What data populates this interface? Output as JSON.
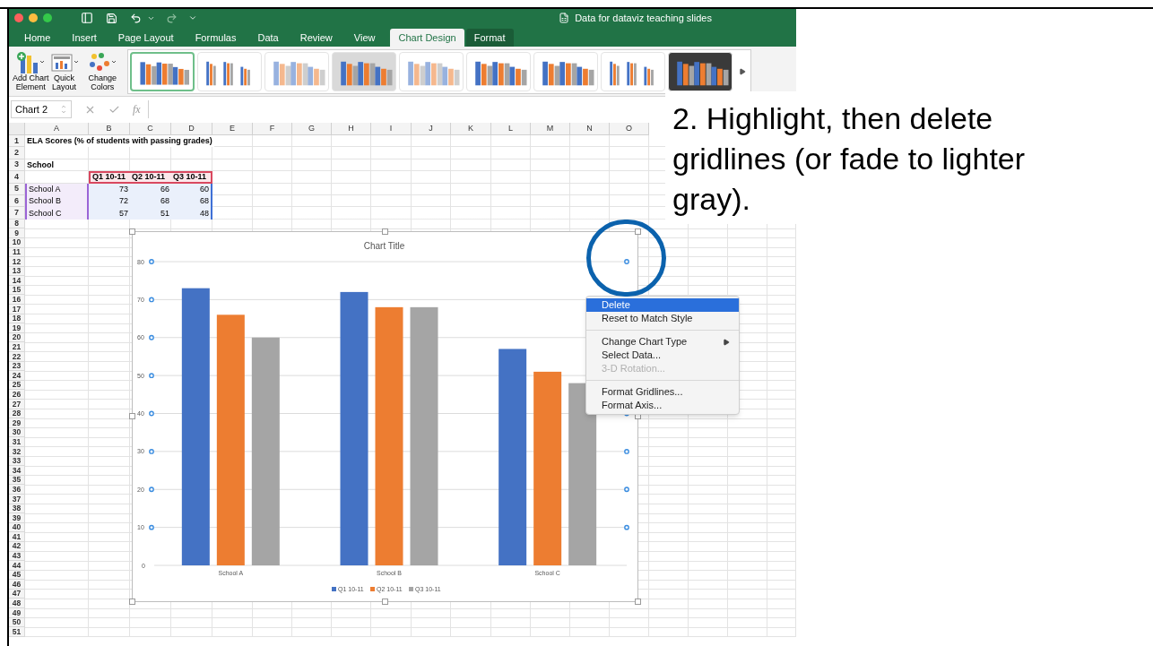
{
  "window": {
    "title": "Data for dataviz teaching slides"
  },
  "tabs": [
    {
      "label": "Home",
      "selected": false,
      "contextual": false
    },
    {
      "label": "Insert",
      "selected": false,
      "contextual": false
    },
    {
      "label": "Page Layout",
      "selected": false,
      "contextual": false
    },
    {
      "label": "Formulas",
      "selected": false,
      "contextual": false
    },
    {
      "label": "Data",
      "selected": false,
      "contextual": false
    },
    {
      "label": "Review",
      "selected": false,
      "contextual": false
    },
    {
      "label": "View",
      "selected": false,
      "contextual": false
    },
    {
      "label": "Chart Design",
      "selected": true,
      "contextual": true
    },
    {
      "label": "Format",
      "selected": false,
      "contextual": true
    }
  ],
  "ribbon": {
    "buttons": [
      {
        "kind": "add-element",
        "lines": [
          "Add Chart",
          "Element"
        ]
      },
      {
        "kind": "quick-layout",
        "lines": [
          "Quick",
          "Layout"
        ]
      },
      {
        "kind": "colors",
        "lines": [
          "Change",
          "Colors"
        ]
      }
    ],
    "chart_styles": [
      {
        "kind": "plain",
        "selected": true
      },
      {
        "kind": "thin",
        "selected": false
      },
      {
        "kind": "pale",
        "selected": false
      },
      {
        "kind": "shaded",
        "selected": false
      },
      {
        "kind": "pale",
        "selected": false
      },
      {
        "kind": "plain",
        "selected": false
      },
      {
        "kind": "plain",
        "selected": false
      },
      {
        "kind": "thin",
        "selected": false
      },
      {
        "kind": "dark",
        "selected": false
      }
    ]
  },
  "formula_bar": {
    "name_box": "Chart 2",
    "function_label": "fx"
  },
  "sheet": {
    "columns": [
      "A",
      "B",
      "C",
      "D",
      "E",
      "F",
      "G",
      "H",
      "I",
      "J",
      "K",
      "L",
      "M",
      "N",
      "O"
    ],
    "rows": [
      {
        "number": "1",
        "kind": "title",
        "text": "ELA Scores (% of students with passing grades)"
      },
      {
        "number": "2",
        "kind": "blank"
      },
      {
        "number": "3",
        "kind": "label",
        "text": "School"
      },
      {
        "number": "4",
        "kind": "headers",
        "cells": [
          "Q1 10-11",
          "Q2 10-11",
          "Q3 10-11"
        ]
      },
      {
        "number": "5",
        "kind": "values",
        "text": "School A",
        "cells": [
          "73",
          "66",
          "60"
        ]
      },
      {
        "number": "6",
        "kind": "values",
        "text": "School B",
        "cells": [
          "72",
          "68",
          "68"
        ]
      },
      {
        "number": "7",
        "kind": "values",
        "text": "School C",
        "cells": [
          "57",
          "51",
          "48"
        ]
      },
      {
        "number": "8",
        "kind": "blank"
      },
      {
        "number": "9",
        "kind": "blank"
      },
      {
        "number": "10",
        "kind": "blank"
      },
      {
        "number": "11",
        "kind": "blank"
      },
      {
        "number": "12",
        "kind": "blank"
      },
      {
        "number": "13",
        "kind": "blank"
      },
      {
        "number": "14",
        "kind": "blank"
      },
      {
        "number": "15",
        "kind": "blank"
      },
      {
        "number": "16",
        "kind": "blank"
      },
      {
        "number": "17",
        "kind": "blank"
      },
      {
        "number": "18",
        "kind": "blank"
      },
      {
        "number": "19",
        "kind": "blank"
      },
      {
        "number": "20",
        "kind": "blank"
      },
      {
        "number": "21",
        "kind": "blank"
      },
      {
        "number": "22",
        "kind": "blank"
      },
      {
        "number": "23",
        "kind": "blank"
      },
      {
        "number": "24",
        "kind": "blank"
      },
      {
        "number": "25",
        "kind": "blank"
      },
      {
        "number": "26",
        "kind": "blank"
      },
      {
        "number": "27",
        "kind": "blank"
      },
      {
        "number": "28",
        "kind": "blank"
      },
      {
        "number": "29",
        "kind": "blank"
      },
      {
        "number": "30",
        "kind": "blank"
      },
      {
        "number": "31",
        "kind": "blank"
      },
      {
        "number": "32",
        "kind": "blank"
      },
      {
        "number": "33",
        "kind": "blank"
      },
      {
        "number": "34",
        "kind": "blank"
      },
      {
        "number": "35",
        "kind": "blank"
      },
      {
        "number": "36",
        "kind": "blank"
      },
      {
        "number": "37",
        "kind": "blank"
      },
      {
        "number": "38",
        "kind": "blank"
      },
      {
        "number": "39",
        "kind": "blank"
      },
      {
        "number": "40",
        "kind": "blank"
      },
      {
        "number": "41",
        "kind": "blank"
      },
      {
        "number": "42",
        "kind": "blank"
      },
      {
        "number": "43",
        "kind": "blank"
      },
      {
        "number": "44",
        "kind": "blank"
      },
      {
        "number": "45",
        "kind": "blank"
      },
      {
        "number": "46",
        "kind": "blank"
      },
      {
        "number": "47",
        "kind": "blank"
      },
      {
        "number": "48",
        "kind": "blank"
      },
      {
        "number": "49",
        "kind": "blank"
      },
      {
        "number": "50",
        "kind": "blank"
      },
      {
        "number": "51",
        "kind": "blank"
      }
    ]
  },
  "chart": {
    "gridlines_selected": true,
    "chart_data": {
      "type": "bar",
      "title": "Chart Title",
      "categories": [
        "School A",
        "School B",
        "School C"
      ],
      "series": [
        {
          "name": "Q1 10-11",
          "color": "#4472c4",
          "values": [
            73,
            72,
            57
          ]
        },
        {
          "name": "Q2 10-11",
          "color": "#ed7d31",
          "values": [
            66,
            68,
            51
          ]
        },
        {
          "name": "Q3 10-11",
          "color": "#a5a5a5",
          "values": [
            60,
            68,
            48
          ]
        }
      ],
      "ylim": [
        0,
        80
      ],
      "yticks": [
        0,
        10,
        20,
        30,
        40,
        50,
        60,
        70,
        80
      ],
      "grid": true,
      "legend": "bottom"
    }
  },
  "context_menu": {
    "groups": [
      [
        {
          "label": "Delete",
          "selected": true,
          "disabled": false,
          "submenu": false
        },
        {
          "label": "Reset to Match Style",
          "selected": false,
          "disabled": false,
          "submenu": false
        }
      ],
      [
        {
          "label": "Change Chart Type",
          "selected": false,
          "disabled": false,
          "submenu": true
        },
        {
          "label": "Select Data...",
          "selected": false,
          "disabled": false,
          "submenu": false
        },
        {
          "label": "3-D Rotation...",
          "selected": false,
          "disabled": true,
          "submenu": false
        }
      ],
      [
        {
          "label": "Format Gridlines...",
          "selected": false,
          "disabled": false,
          "submenu": false
        },
        {
          "label": "Format Axis...",
          "selected": false,
          "disabled": false,
          "submenu": false
        }
      ]
    ]
  },
  "annotation": {
    "text": "2. Highlight, then delete gridlines (or fade to lighter gray)."
  }
}
